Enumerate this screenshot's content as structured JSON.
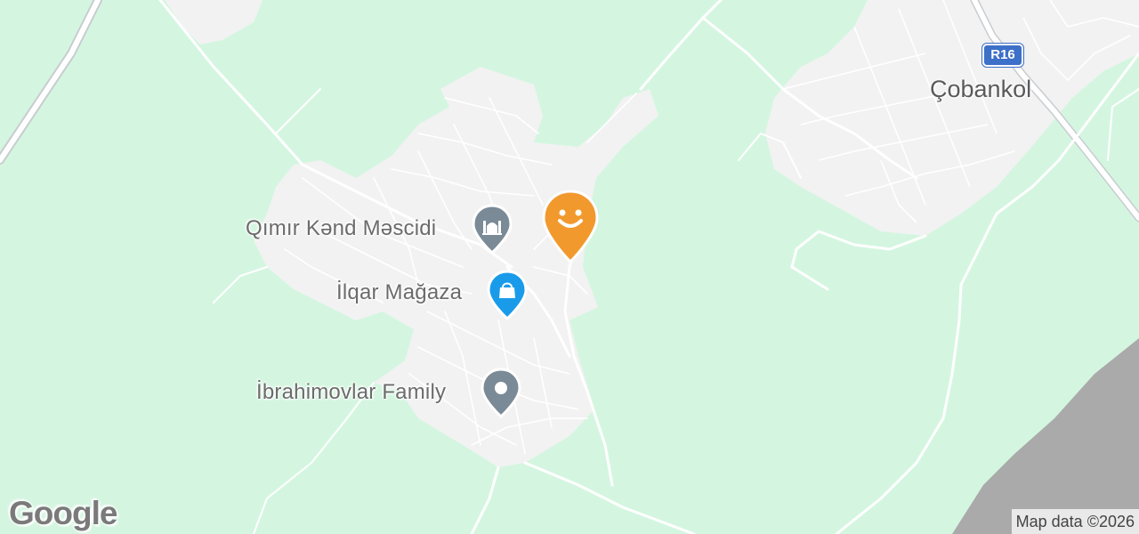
{
  "map": {
    "places": [
      {
        "name": "Qımır Kənd Məscidi",
        "icon": "mosque-icon",
        "color": "#7a8a96"
      },
      {
        "name": "İlqar Mağaza",
        "icon": "shopping-bag-icon",
        "color": "#1a9bea"
      },
      {
        "name": "İbrahimovlar Family",
        "icon": "place-dot-icon",
        "color": "#7a8a96"
      }
    ],
    "city_label": "Çobankol",
    "road_shield": "R16",
    "user_marker": {
      "icon": "smiley-marker-icon",
      "color": "#f2992e"
    }
  },
  "branding": {
    "logo_text": "Google",
    "attribution": "Map data ©2026"
  },
  "colors": {
    "land": "#d4f6e0",
    "urban": "#f2f2f2",
    "water_grey": "#aaaaaa"
  }
}
